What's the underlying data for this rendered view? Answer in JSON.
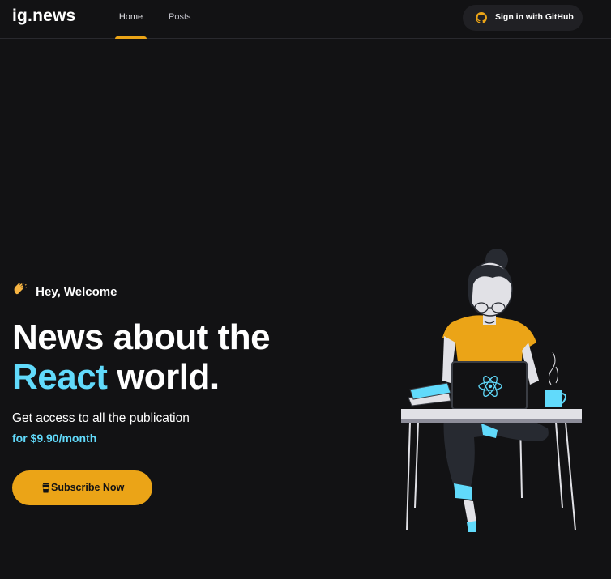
{
  "header": {
    "logo": "ig.news",
    "nav": [
      {
        "label": "Home",
        "active": true
      },
      {
        "label": "Posts",
        "active": false
      }
    ],
    "signin_label": "Sign in with GitHub"
  },
  "hero": {
    "greeting": "Hey, Welcome",
    "headline_line1": "News about the",
    "headline_accent": "React",
    "headline_rest": "world.",
    "subtitle": "Get access to all the publication",
    "price": "for $9.90/month",
    "subscribe_label": "Subscribe Now"
  },
  "icons": {
    "github": "github-icon",
    "clap": "clapping-hands-icon",
    "coffee": "coffee-cup-icon",
    "illustration": "woman-at-laptop-illustration"
  },
  "colors": {
    "background": "#121214",
    "accent_yellow": "#eba417",
    "accent_cyan": "#61dafb"
  }
}
